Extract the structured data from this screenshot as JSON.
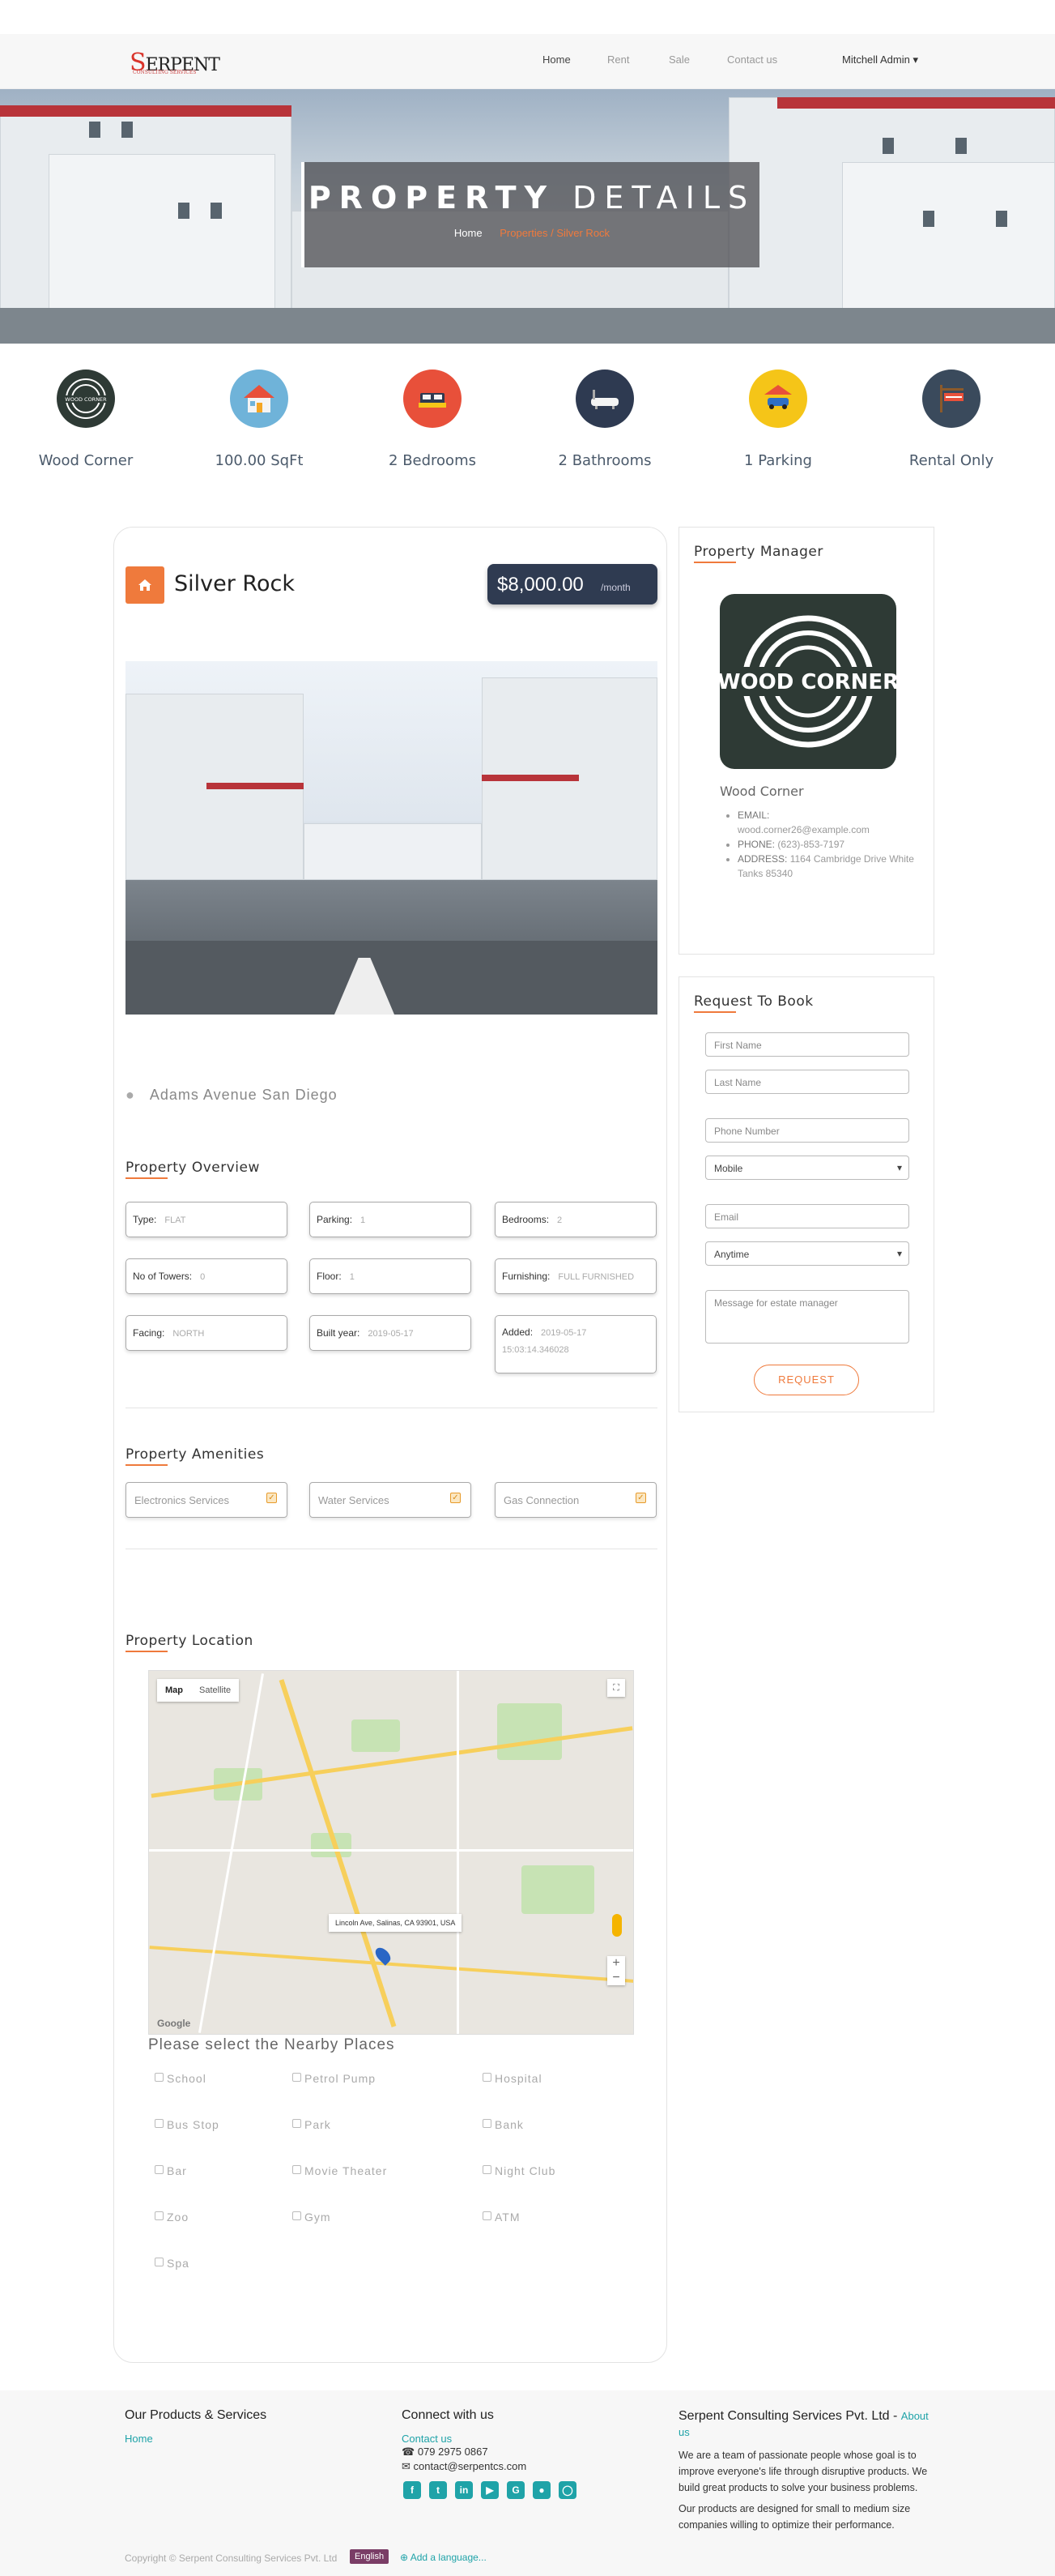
{
  "brand": {
    "name": "SERPENT",
    "tagline": "CONSULTING SERVICES"
  },
  "nav": {
    "links": [
      "Home",
      "Rent",
      "Sale",
      "Contact us"
    ],
    "user": "Mitchell Admin"
  },
  "hero": {
    "title_bold": "PROPERTY",
    "title_rest": "DETAILS",
    "crumb_home": "Home",
    "crumb_trail": "Properties / Silver Rock"
  },
  "features": [
    {
      "label": "Wood Corner",
      "icon": "wood-corner-logo-icon",
      "color": "#2e3a35"
    },
    {
      "label": "100.00 SqFt",
      "icon": "house-area-icon",
      "color": "#6fb3d9"
    },
    {
      "label": "2 Bedrooms",
      "icon": "bed-icon",
      "color": "#e8503a"
    },
    {
      "label": "2 Bathrooms",
      "icon": "bathtub-icon",
      "color": "#2e3a51"
    },
    {
      "label": "1 Parking",
      "icon": "car-icon",
      "color": "#f5c518"
    },
    {
      "label": "Rental Only",
      "icon": "for-rent-sign-icon",
      "color": "#3a4a5c"
    }
  ],
  "property": {
    "name": "Silver Rock",
    "price": "$8,000.00",
    "per": "/month",
    "address": "Adams Avenue San Diego"
  },
  "overview": {
    "title": "Property Overview",
    "items": [
      {
        "k": "Type:",
        "v": "FLAT"
      },
      {
        "k": "Parking:",
        "v": "1"
      },
      {
        "k": "Bedrooms:",
        "v": "2"
      },
      {
        "k": "No of Towers:",
        "v": "0"
      },
      {
        "k": "Floor:",
        "v": "1"
      },
      {
        "k": "Furnishing:",
        "v": "FULL FURNISHED"
      },
      {
        "k": "Facing:",
        "v": "NORTH"
      },
      {
        "k": "Built year:",
        "v": "2019-05-17"
      },
      {
        "k": "Added:",
        "v": "2019-05-17 15:03:14.346028"
      }
    ]
  },
  "amenities": {
    "title": "Property Amenities",
    "items": [
      "Electronics Services",
      "Water Services",
      "Gas Connection"
    ]
  },
  "location": {
    "title": "Property Location",
    "map_tab_active": "Map",
    "map_tab_inactive": "Satellite",
    "pin_address": "Lincoln Ave, Salinas, CA 93901, USA",
    "google": "Google",
    "nearby_title": "Please select the Nearby Places",
    "nearby": [
      "School",
      "Petrol Pump",
      "Hospital",
      "Bus Stop",
      "Park",
      "Bank",
      "Bar",
      "Movie Theater",
      "Night Club",
      "Zoo",
      "Gym",
      "ATM",
      "Spa"
    ]
  },
  "manager": {
    "title": "Property Manager",
    "logo_text": "WOOD CORNER",
    "name": "Wood Corner",
    "email_label": "EMAIL:",
    "email": "wood.corner26@example.com",
    "phone_label": "PHONE:",
    "phone": "(623)-853-7197",
    "address_label": "ADDRESS:",
    "address": "1164 Cambridge Drive White Tanks 85340"
  },
  "booking": {
    "title": "Request To Book",
    "first_name": "First Name",
    "last_name": "Last Name",
    "phone": "Phone Number",
    "phone_type": "Mobile",
    "email": "Email",
    "time": "Anytime",
    "message": "Message for estate manager",
    "button": "REQUEST"
  },
  "footer": {
    "col1_title": "Our Products & Services",
    "col1_link": "Home",
    "col2_title": "Connect with us",
    "contact_link": "Contact us",
    "phone": "079 2975 0867",
    "email": "contact@serpentcs.com",
    "col3_title": "Serpent Consulting Services Pvt. Ltd",
    "about_link": "About us",
    "about_p1": "We are a team of passionate people whose goal is to improve everyone's life through disruptive products. We build great products to solve your business problems.",
    "about_p2": "Our products are designed for small to medium size companies willing to optimize their performance.",
    "copyright": "Copyright © Serpent Consulting Services Pvt. Ltd",
    "language": "English",
    "add_language": "Add a language..."
  },
  "colors": {
    "accent": "#ef7a3c",
    "dark": "#2f3b51",
    "teal": "#1fa3a8"
  }
}
